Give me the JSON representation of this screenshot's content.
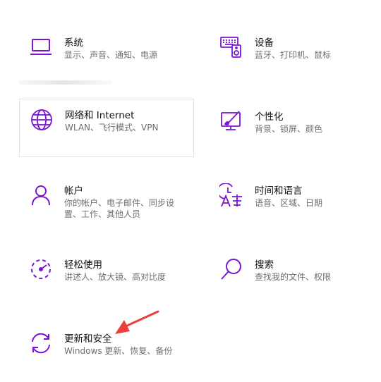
{
  "accent_color": "#7a14d6",
  "annotation_color": "#e8413c",
  "tiles": [
    {
      "name": "system",
      "icon": "laptop-icon",
      "title": "系统",
      "desc": "显示、声音、通知、电源"
    },
    {
      "name": "devices",
      "icon": "devices-icon",
      "title": "设备",
      "desc": "蓝牙、打印机、鼠标"
    },
    {
      "name": "network",
      "icon": "globe-icon",
      "title": "网络和 Internet",
      "desc": "WLAN、飞行模式、VPN"
    },
    {
      "name": "personalization",
      "icon": "paint-brush-icon",
      "title": "个性化",
      "desc": "背景、锁屏、颜色"
    },
    {
      "name": "accounts",
      "icon": "user-icon",
      "title": "帐户",
      "desc": "你的帐户、电子邮件、同步设置、工作、其他人员"
    },
    {
      "name": "time-language",
      "icon": "time-language-icon",
      "title": "时间和语言",
      "desc": "语音、区域、日期"
    },
    {
      "name": "ease-of-access",
      "icon": "ease-of-access-icon",
      "title": "轻松使用",
      "desc": "讲述人、放大镜、高对比度"
    },
    {
      "name": "search",
      "icon": "search-icon",
      "title": "搜索",
      "desc": "查找我的文件、权限"
    },
    {
      "name": "update-security",
      "icon": "update-sync-icon",
      "title": "更新和安全",
      "desc": "Windows 更新、恢复、备份"
    }
  ]
}
